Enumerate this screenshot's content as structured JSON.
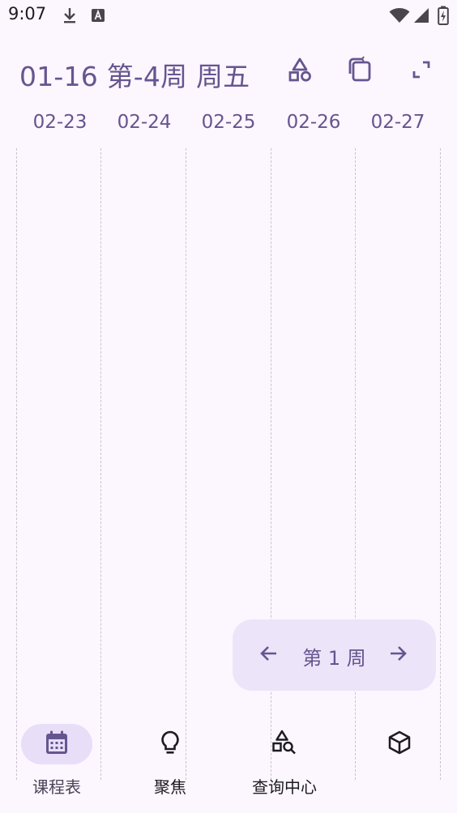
{
  "status_bar": {
    "time": "9:07",
    "icons": [
      "download-icon",
      "a-box-icon",
      "wifi-icon",
      "signal-icon",
      "battery-charging-icon"
    ]
  },
  "header": {
    "title": "01-16 第-4周 周五",
    "actions": [
      "shapes-icon",
      "copy-rotate-icon",
      "fullscreen-icon"
    ]
  },
  "days": [
    "02-23",
    "02-24",
    "02-25",
    "02-26",
    "02-27"
  ],
  "week_switcher": {
    "label": "第 1 周",
    "prev_icon": "arrow-left-icon",
    "next_icon": "arrow-right-icon"
  },
  "bottom_nav": {
    "items": [
      {
        "label": "课程表",
        "icon": "calendar-icon",
        "active": true
      },
      {
        "label": "聚焦",
        "icon": "lightbulb-icon",
        "active": false
      },
      {
        "label": "查询中心",
        "icon": "shapes-search-icon",
        "active": false
      },
      {
        "label": "",
        "icon": "cube-icon",
        "active": false
      }
    ]
  },
  "colors": {
    "background": "#fcf6fe",
    "primary": "#65558f",
    "secondary_container": "#ece4f9",
    "nav_indicator": "#e8def8",
    "grid_line": "#cbc3cf"
  }
}
